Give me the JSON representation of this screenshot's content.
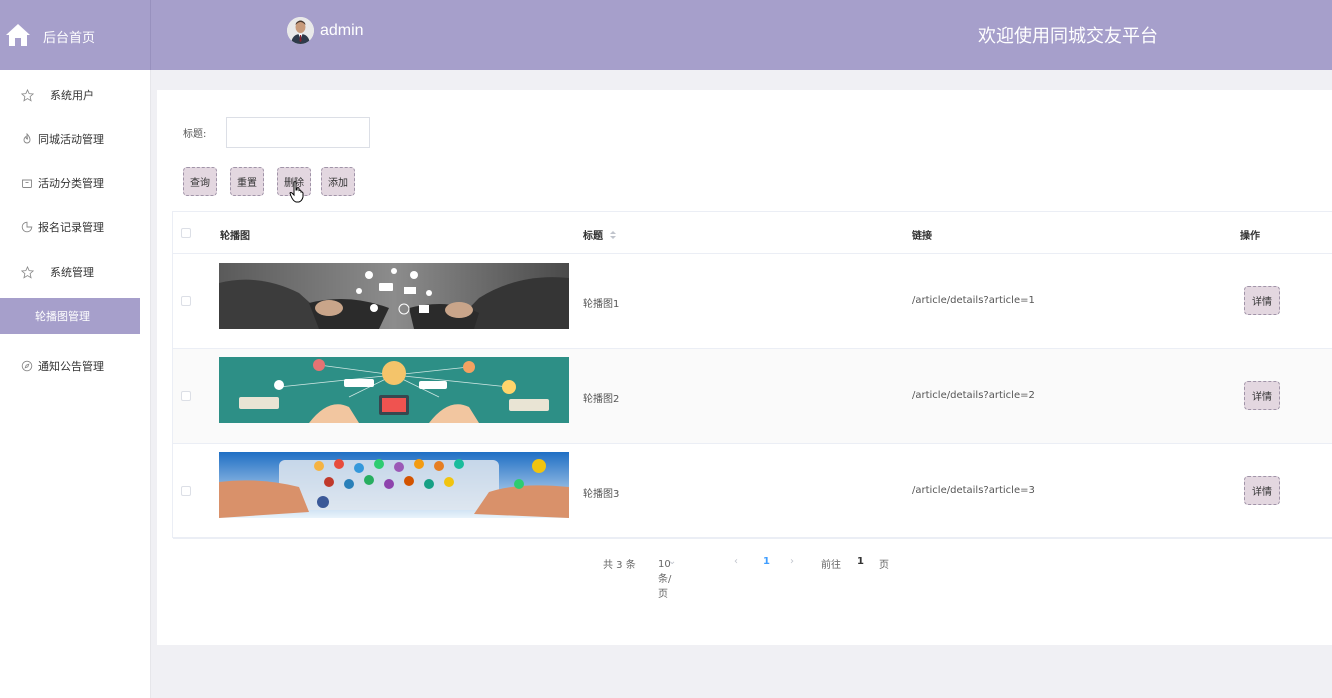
{
  "header": {
    "home_label": "后台首页",
    "user_name": "admin",
    "welcome": "欢迎使用同城交友平台"
  },
  "sidebar": {
    "items": [
      {
        "label": "系统用户",
        "icon": "star-icon"
      },
      {
        "label": "同城活动管理",
        "icon": "fire-icon"
      },
      {
        "label": "活动分类管理",
        "icon": "box-icon"
      },
      {
        "label": "报名记录管理",
        "icon": "pie-icon"
      },
      {
        "label": "系统管理",
        "icon": "star-icon"
      },
      {
        "label": "轮播图管理",
        "icon": "",
        "active": true
      },
      {
        "label": "通知公告管理",
        "icon": "compass-icon"
      }
    ]
  },
  "search": {
    "label": "标题:",
    "value": "",
    "placeholder": ""
  },
  "toolbar": {
    "query": "查询",
    "reset": "重置",
    "delete": "删除",
    "add": "添加"
  },
  "table": {
    "columns": {
      "image": "轮播图",
      "title": "标题",
      "link": "链接",
      "action": "操作"
    },
    "rows": [
      {
        "title": "轮播图1",
        "link": "/article/details?article=1",
        "action": "详情"
      },
      {
        "title": "轮播图2",
        "link": "/article/details?article=2",
        "action": "详情"
      },
      {
        "title": "轮播图3",
        "link": "/article/details?article=3",
        "action": "详情"
      }
    ]
  },
  "pagination": {
    "total": "共 3 条",
    "page_size": "10条/页",
    "current_page": "1",
    "goto_label": "前往",
    "goto_value": "1",
    "page_unit": "页"
  },
  "colors": {
    "accent": "#a69fcb",
    "button_bg": "#e3d7e0",
    "pager_active": "#409eff"
  }
}
